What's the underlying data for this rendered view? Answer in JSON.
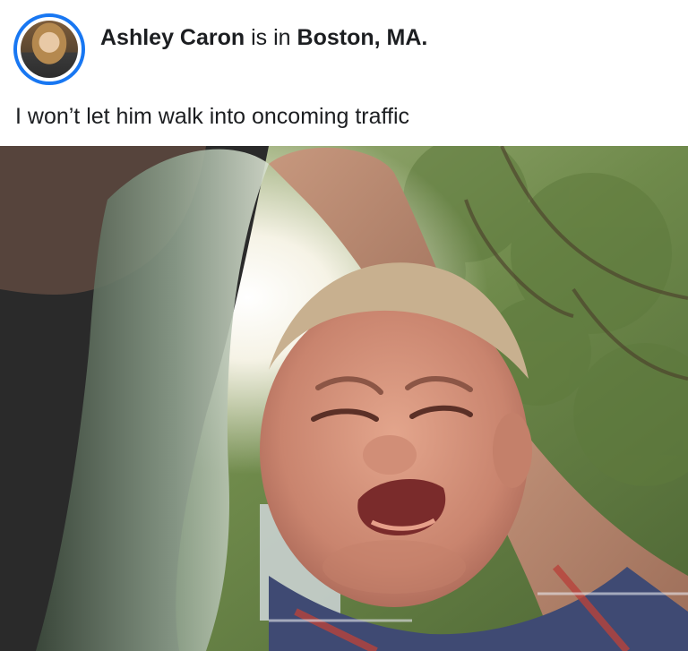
{
  "post": {
    "author_name": "Ashley Caron",
    "connector": "is in",
    "location": "Boston, MA.",
    "caption": "I won’t let him walk into oncoming traffic"
  },
  "colors": {
    "avatar_ring": "#1877f2",
    "text": "#1c1e21",
    "background": "#ffffff"
  },
  "icons": {
    "avatar": "profile-avatar"
  }
}
